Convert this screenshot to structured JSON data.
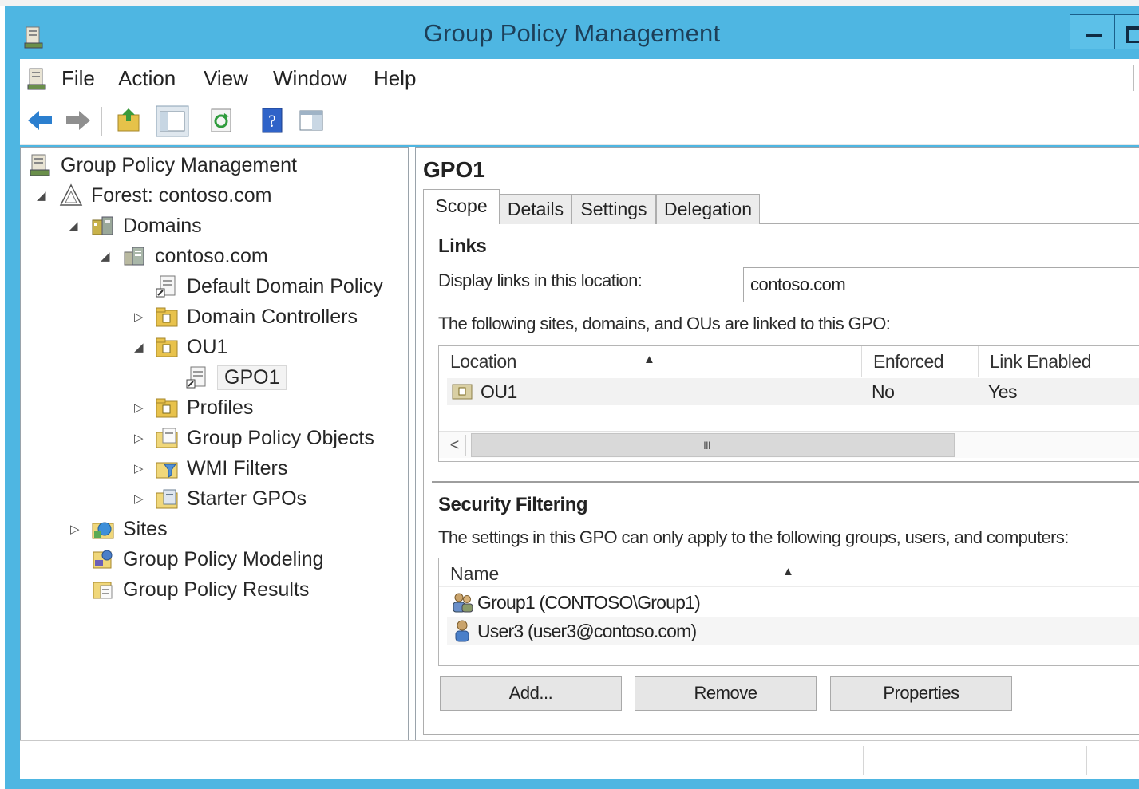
{
  "window": {
    "title": "Group Policy Management"
  },
  "menu": {
    "items": [
      "File",
      "Action",
      "View",
      "Window",
      "Help"
    ]
  },
  "toolbar": {
    "buttons": [
      "back-arrow-icon",
      "forward-arrow-icon",
      "up-folder-icon",
      "show-hide-tree-icon",
      "refresh-icon",
      "help-icon",
      "action-pane-icon"
    ]
  },
  "tree": {
    "items": [
      {
        "label": "Group Policy Management",
        "icon": "gpm-console-icon",
        "expander": ""
      },
      {
        "label": "Forest: contoso.com",
        "icon": "forest-icon",
        "expander": "◢"
      },
      {
        "label": "Domains",
        "icon": "domains-icon",
        "expander": "◢"
      },
      {
        "label": "contoso.com",
        "icon": "domain-icon",
        "expander": "◢"
      },
      {
        "label": "Default Domain Policy",
        "icon": "gpo-link-icon",
        "expander": ""
      },
      {
        "label": "Domain Controllers",
        "icon": "ou-folder-icon",
        "expander": "▷"
      },
      {
        "label": "OU1",
        "icon": "ou-folder-icon",
        "expander": "◢"
      },
      {
        "label": "GPO1",
        "icon": "gpo-link-icon",
        "expander": ""
      },
      {
        "label": "Profiles",
        "icon": "ou-folder-icon",
        "expander": "▷"
      },
      {
        "label": "Group Policy Objects",
        "icon": "gpo-container-icon",
        "expander": "▷"
      },
      {
        "label": "WMI Filters",
        "icon": "wmi-filters-icon",
        "expander": "▷"
      },
      {
        "label": "Starter GPOs",
        "icon": "starter-gpos-icon",
        "expander": "▷"
      },
      {
        "label": "Sites",
        "icon": "sites-icon",
        "expander": "▷"
      },
      {
        "label": "Group Policy Modeling",
        "icon": "modeling-icon",
        "expander": ""
      },
      {
        "label": "Group Policy Results",
        "icon": "results-icon",
        "expander": ""
      }
    ]
  },
  "details": {
    "title": "GPO1",
    "tabs": [
      "Scope",
      "Details",
      "Settings",
      "Delegation"
    ],
    "active_tab": "Scope",
    "links": {
      "section_title": "Links",
      "display_label": "Display links in this location:",
      "location_value": "contoso.com",
      "linked_text": "The following sites, domains, and OUs are linked to this GPO:",
      "columns": [
        "Location",
        "Enforced",
        "Link Enabled"
      ],
      "sort_indicator": "▲",
      "rows": [
        {
          "location": "OU1",
          "enforced": "No",
          "link_enabled": "Yes"
        }
      ],
      "scroll_left": "<",
      "scroll_grip": "III"
    },
    "security": {
      "section_title": "Security Filtering",
      "description": "The settings in this GPO can only apply to the following groups, users, and computers:",
      "column": "Name",
      "sort_indicator": "▲",
      "rows": [
        {
          "name": "Group1 (CONTOSO\\Group1)",
          "icon": "group-icon"
        },
        {
          "name": "User3 (user3@contoso.com)",
          "icon": "user-icon"
        }
      ],
      "buttons": [
        "Add...",
        "Remove",
        "Properties"
      ]
    }
  },
  "colors": {
    "frame": "#4eb6e2",
    "title_text": "#1d3f58"
  }
}
